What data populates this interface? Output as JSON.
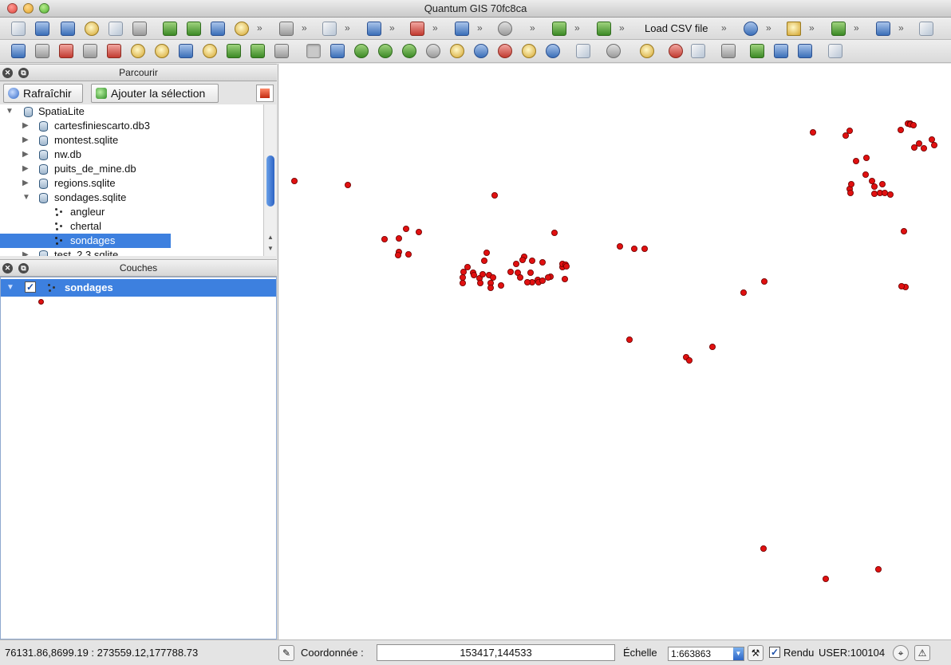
{
  "window": {
    "title": "Quantum GIS 70fc8ca"
  },
  "toolbar": {
    "plugin_label": "Load CSV file",
    "more": "»"
  },
  "browser": {
    "title": "Parcourir",
    "refresh_label": "Rafraîchir",
    "add_selection_label": "Ajouter la sélection",
    "tree": [
      {
        "label": "SpatiaLite",
        "type": "root",
        "expanded": true
      },
      {
        "label": "cartesfiniescarto.db3",
        "type": "db"
      },
      {
        "label": "montest.sqlite",
        "type": "db"
      },
      {
        "label": "nw.db",
        "type": "db"
      },
      {
        "label": "puits_de_mine.db",
        "type": "db"
      },
      {
        "label": "regions.sqlite",
        "type": "db"
      },
      {
        "label": "sondages.sqlite",
        "type": "db",
        "expanded": true
      },
      {
        "label": "angleur",
        "type": "layer"
      },
      {
        "label": "chertal",
        "type": "layer"
      },
      {
        "label": "sondages",
        "type": "layer",
        "selected": true
      },
      {
        "label": "test_2.3.sqlite",
        "type": "db"
      }
    ]
  },
  "layers": {
    "title": "Couches",
    "items": [
      {
        "label": "sondages",
        "checked": true,
        "check_mark": "✓"
      }
    ],
    "symbol_color": "#e01010"
  },
  "map": {
    "point_color": "#e01010",
    "point_stroke": "#6a0000"
  },
  "status": {
    "extent": "76131.86,8699.19 : 273559.12,177788.73",
    "coord_label": "Coordonnée :",
    "coord_value": "153417,144533",
    "scale_label": "Échelle",
    "scale_value": "1:663863",
    "render_label": "Rendu",
    "render_checked": true,
    "render_check_mark": "✓",
    "crs": "USER:100104"
  }
}
